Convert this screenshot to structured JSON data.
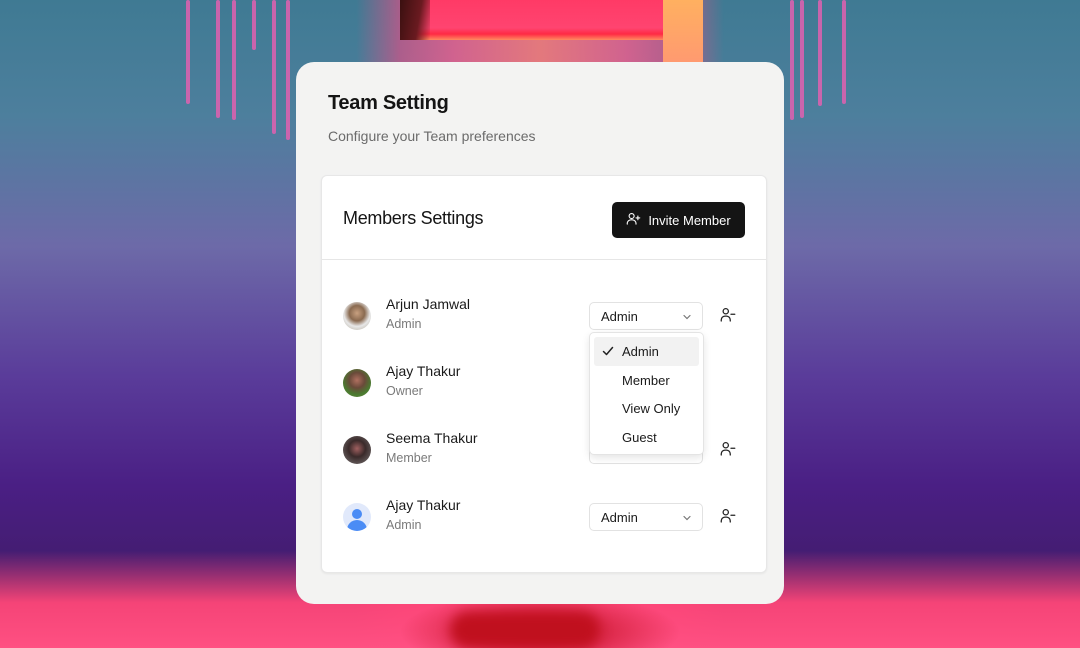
{
  "panel": {
    "title": "Team Setting",
    "subtitle": "Configure your Team preferences"
  },
  "card": {
    "title": "Members Settings",
    "invite_button": {
      "label": "Invite Member",
      "icon": "user-plus-icon"
    }
  },
  "members": [
    {
      "name": "Arjun Jamwal",
      "role": "Admin",
      "avatar": "photo",
      "select_value": "Admin",
      "has_select": true,
      "dropdown_open": true
    },
    {
      "name": "Ajay Thakur",
      "role": "Owner",
      "avatar": "photo",
      "has_select": false
    },
    {
      "name": "Seema Thakur",
      "role": "Member",
      "avatar": "photo",
      "select_value": "",
      "has_select": true
    },
    {
      "name": "Ajay Thakur",
      "role": "Admin",
      "avatar": "default-user",
      "select_value": "Admin",
      "has_select": true
    }
  ],
  "role_dropdown": {
    "options": [
      "Admin",
      "Member",
      "View Only",
      "Guest"
    ],
    "selected": "Admin"
  },
  "icons": {
    "remove_member": "user-minus-icon",
    "select_chevron": "chevron-down-icon",
    "selected_check": "check-icon"
  },
  "colors": {
    "panel_bg": "#f3f3f2",
    "card_bg": "#ffffff",
    "primary_button": "#141414",
    "default_avatar": "#4b8cf5"
  }
}
